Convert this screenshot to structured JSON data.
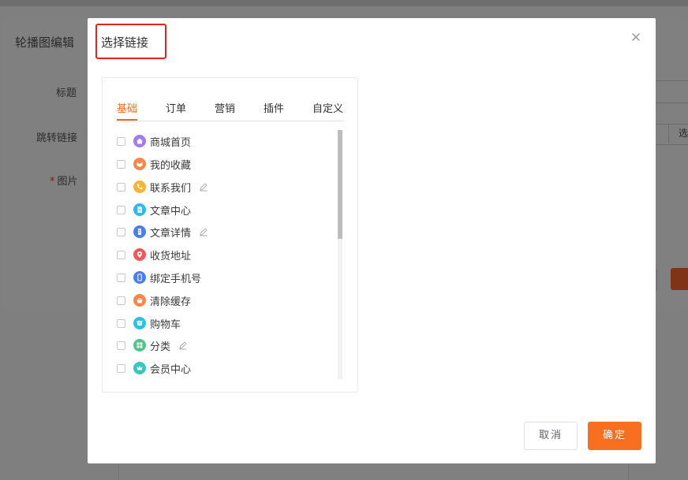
{
  "background": {
    "page_title": "轮播图编辑",
    "labels": {
      "title": "标题",
      "link": "跳转链接",
      "image_required_mark": "*",
      "image": "图片"
    },
    "select_button_partial": "选"
  },
  "modal": {
    "title": "选择链接",
    "tabs": [
      {
        "label": "基础",
        "active": true
      },
      {
        "label": "订单",
        "active": false
      },
      {
        "label": "营销",
        "active": false
      },
      {
        "label": "插件",
        "active": false
      },
      {
        "label": "自定义",
        "active": false
      }
    ],
    "items": [
      {
        "label": "商城首页",
        "icon": "home-icon",
        "color": "#a07cf0",
        "editable": false,
        "checked": false
      },
      {
        "label": "我的收藏",
        "icon": "heart-box-icon",
        "color": "#f7884a",
        "editable": false,
        "checked": false
      },
      {
        "label": "联系我们",
        "icon": "phone-icon",
        "color": "#f6b534",
        "editable": true,
        "checked": false
      },
      {
        "label": "文章中心",
        "icon": "document-icon",
        "color": "#2bb9f1",
        "editable": false,
        "checked": false
      },
      {
        "label": "文章详情",
        "icon": "file-detail-icon",
        "color": "#4a7df0",
        "editable": true,
        "checked": false
      },
      {
        "label": "收货地址",
        "icon": "location-pin-icon",
        "color": "#f5565a",
        "editable": false,
        "checked": false
      },
      {
        "label": "绑定手机号",
        "icon": "mobile-phone-icon",
        "color": "#4a7df0",
        "editable": false,
        "checked": false
      },
      {
        "label": "清除缓存",
        "icon": "broom-icon",
        "color": "#f7884a",
        "editable": false,
        "checked": false
      },
      {
        "label": "购物车",
        "icon": "cart-icon",
        "color": "#2bc1e8",
        "editable": false,
        "checked": false
      },
      {
        "label": "分类",
        "icon": "grid-icon",
        "color": "#52c48a",
        "editable": true,
        "checked": false
      },
      {
        "label": "会员中心",
        "icon": "crown-icon",
        "color": "#36c8c0",
        "editable": false,
        "checked": false
      }
    ],
    "buttons": {
      "cancel": "取消",
      "confirm": "确定"
    },
    "colors": {
      "accent": "#f96f20",
      "title_highlight_border": "#e8231b"
    }
  }
}
